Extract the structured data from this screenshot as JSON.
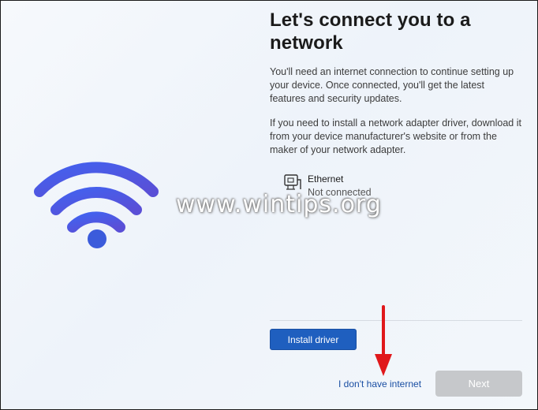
{
  "header": {
    "title_line1": "Let's connect you to a",
    "title_line2": "network"
  },
  "body": {
    "para1": "You'll need an internet connection to continue setting up your device. Once connected, you'll get the latest features and security updates.",
    "para2": "If you need to install a network adapter driver, download it from your device manufacturer's website or from the maker of your network adapter."
  },
  "network": {
    "icon": "ethernet-icon",
    "name": "Ethernet",
    "status": "Not connected"
  },
  "illustration": {
    "icon": "wifi-icon",
    "colors": [
      "#3b5bdb",
      "#5a7df0",
      "#4c6ef5"
    ]
  },
  "actions": {
    "install_label": "Install driver",
    "no_internet_label": "I don't have internet",
    "next_label": "Next"
  },
  "watermark": "www.wintips.org",
  "colors": {
    "accent": "#1f5fbf",
    "link": "#1a4fa3",
    "disabled": "#c6c8cb",
    "annotation_arrow": "#e0181b"
  }
}
